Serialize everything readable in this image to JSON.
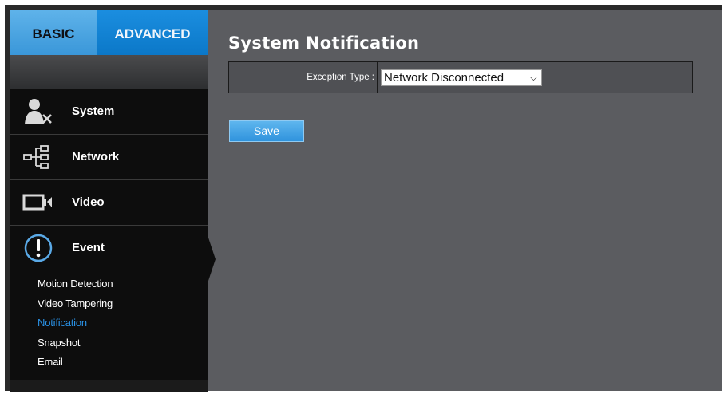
{
  "tabs": {
    "basic": "BASIC",
    "advanced": "ADVANCED"
  },
  "nav": {
    "system": "System",
    "network": "Network",
    "video": "Video",
    "event": "Event",
    "event_items": [
      "Motion Detection",
      "Video Tampering",
      "Notification",
      "Snapshot",
      "Email"
    ],
    "active_item": "Notification"
  },
  "page": {
    "title": "System Notification",
    "exception_label": "Exception Type :",
    "exception_value": "Network Disconnected",
    "save_label": "Save"
  },
  "icons": {
    "system": "user-settings-icon",
    "network": "network-tree-icon",
    "video": "video-camera-icon",
    "event": "alert-icon"
  },
  "colors": {
    "accent": "#1b8ee0",
    "active_link": "#2a92e6"
  }
}
